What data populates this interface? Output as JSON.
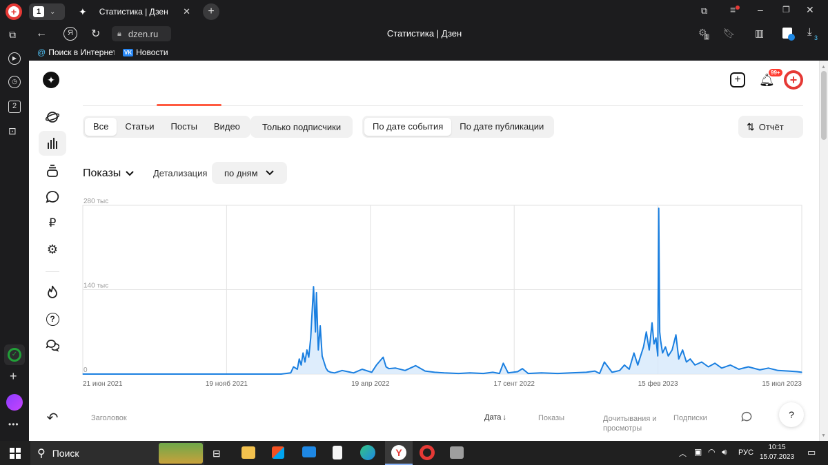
{
  "browser": {
    "tab_count": "1",
    "tab_title": "Статистика | Дзен",
    "address": "dzen.ru",
    "page_title": "Статистика | Дзен",
    "extension_badge": "1",
    "download_badge": "3",
    "bookmarks": [
      {
        "label": "Поиск в Интернете",
        "icon": "search-at-icon"
      },
      {
        "label": "Новости",
        "icon": "vk-icon"
      }
    ],
    "sidebar_badge": "2"
  },
  "header": {
    "notif_badge": "99+"
  },
  "filters": {
    "content_types": [
      "Все",
      "Статьи",
      "Посты",
      "Видео"
    ],
    "content_selected": "Все",
    "subscribers_only": "Только подписчики",
    "date_modes": [
      "По дате события",
      "По дате публикации"
    ],
    "date_selected": "По дате события",
    "report_button": "Отчёт"
  },
  "metric": {
    "label": "Показы",
    "detail_label": "Детализация",
    "detail_value": "по дням"
  },
  "chart_data": {
    "type": "area",
    "ylim": [
      0,
      280000
    ],
    "yticks": [
      {
        "value": 280000,
        "label": "280 тыс"
      },
      {
        "value": 140000,
        "label": "140 тыс"
      },
      {
        "value": 0,
        "label": "0"
      }
    ],
    "xticks": [
      "21 июн 2021",
      "19 нояб 2021",
      "19 апр 2022",
      "17 сент 2022",
      "15 фев 2023",
      "15 июл 2023"
    ],
    "x_range": [
      "2021-06-21",
      "2023-07-15"
    ],
    "series": [
      {
        "values_sampled_daily_hint": "estimated points",
        "x": [
          "2021-06-21",
          "2021-11-19",
          "2022-01-15",
          "2022-01-25",
          "2022-01-28",
          "2022-02-01",
          "2022-02-03",
          "2022-02-05",
          "2022-02-07",
          "2022-02-09",
          "2022-02-11",
          "2022-02-13",
          "2022-02-15",
          "2022-02-16",
          "2022-02-18",
          "2022-02-20",
          "2022-02-21",
          "2022-02-23",
          "2022-02-25",
          "2022-02-27",
          "2022-03-01",
          "2022-03-03",
          "2022-03-05",
          "2022-03-08",
          "2022-03-12",
          "2022-03-20",
          "2022-04-01",
          "2022-04-10",
          "2022-04-20",
          "2022-04-25",
          "2022-05-02",
          "2022-05-05",
          "2022-05-08",
          "2022-05-15",
          "2022-05-25",
          "2022-06-05",
          "2022-06-15",
          "2022-06-25",
          "2022-07-05",
          "2022-07-20",
          "2022-08-01",
          "2022-08-15",
          "2022-08-25",
          "2022-09-01",
          "2022-09-05",
          "2022-09-10",
          "2022-09-20",
          "2022-09-25",
          "2022-10-01",
          "2022-10-15",
          "2022-11-01",
          "2022-11-15",
          "2022-12-01",
          "2022-12-10",
          "2022-12-15",
          "2022-12-20",
          "2022-12-28",
          "2023-01-05",
          "2023-01-10",
          "2023-01-15",
          "2023-01-20",
          "2023-01-24",
          "2023-01-27",
          "2023-01-30",
          "2023-02-02",
          "2023-02-05",
          "2023-02-08",
          "2023-02-10",
          "2023-02-12",
          "2023-02-14",
          "2023-02-15",
          "2023-02-16",
          "2023-02-17",
          "2023-02-19",
          "2023-02-22",
          "2023-02-25",
          "2023-03-01",
          "2023-03-05",
          "2023-03-08",
          "2023-03-12",
          "2023-03-16",
          "2023-03-20",
          "2023-03-25",
          "2023-04-01",
          "2023-04-08",
          "2023-04-15",
          "2023-04-22",
          "2023-05-01",
          "2023-05-10",
          "2023-05-20",
          "2023-06-01",
          "2023-06-10",
          "2023-06-20",
          "2023-07-01",
          "2023-07-10",
          "2023-07-15"
        ],
        "values": [
          0,
          0,
          0,
          2000,
          12000,
          8000,
          25000,
          15000,
          35000,
          20000,
          40000,
          28000,
          60000,
          90000,
          145000,
          70000,
          135000,
          40000,
          80000,
          30000,
          20000,
          10000,
          5000,
          3000,
          2000,
          6000,
          2000,
          8000,
          3000,
          15000,
          28000,
          12000,
          9000,
          10000,
          6000,
          14000,
          5000,
          3000,
          2000,
          1000,
          2000,
          1000,
          3000,
          1000,
          18000,
          2000,
          4000,
          9000,
          1000,
          2000,
          1000,
          2000,
          3000,
          5000,
          1000,
          20000,
          3000,
          6000,
          15000,
          8000,
          35000,
          15000,
          30000,
          45000,
          70000,
          40000,
          85000,
          50000,
          60000,
          30000,
          275000,
          70000,
          55000,
          35000,
          45000,
          30000,
          40000,
          65000,
          25000,
          40000,
          20000,
          25000,
          15000,
          20000,
          12000,
          18000,
          10000,
          15000,
          8000,
          12000,
          7000,
          10000,
          6000,
          5000,
          4000,
          3000
        ]
      }
    ]
  },
  "table": {
    "columns": [
      "Заголовок",
      "Дата",
      "Показы",
      "Дочитывания и просмотры",
      "Подписки"
    ],
    "sort_arrow": "↓",
    "help": "?"
  },
  "taskbar": {
    "search_label": "Поиск",
    "lang": "РУС",
    "time": "10:15",
    "date": "15.07.2023"
  }
}
